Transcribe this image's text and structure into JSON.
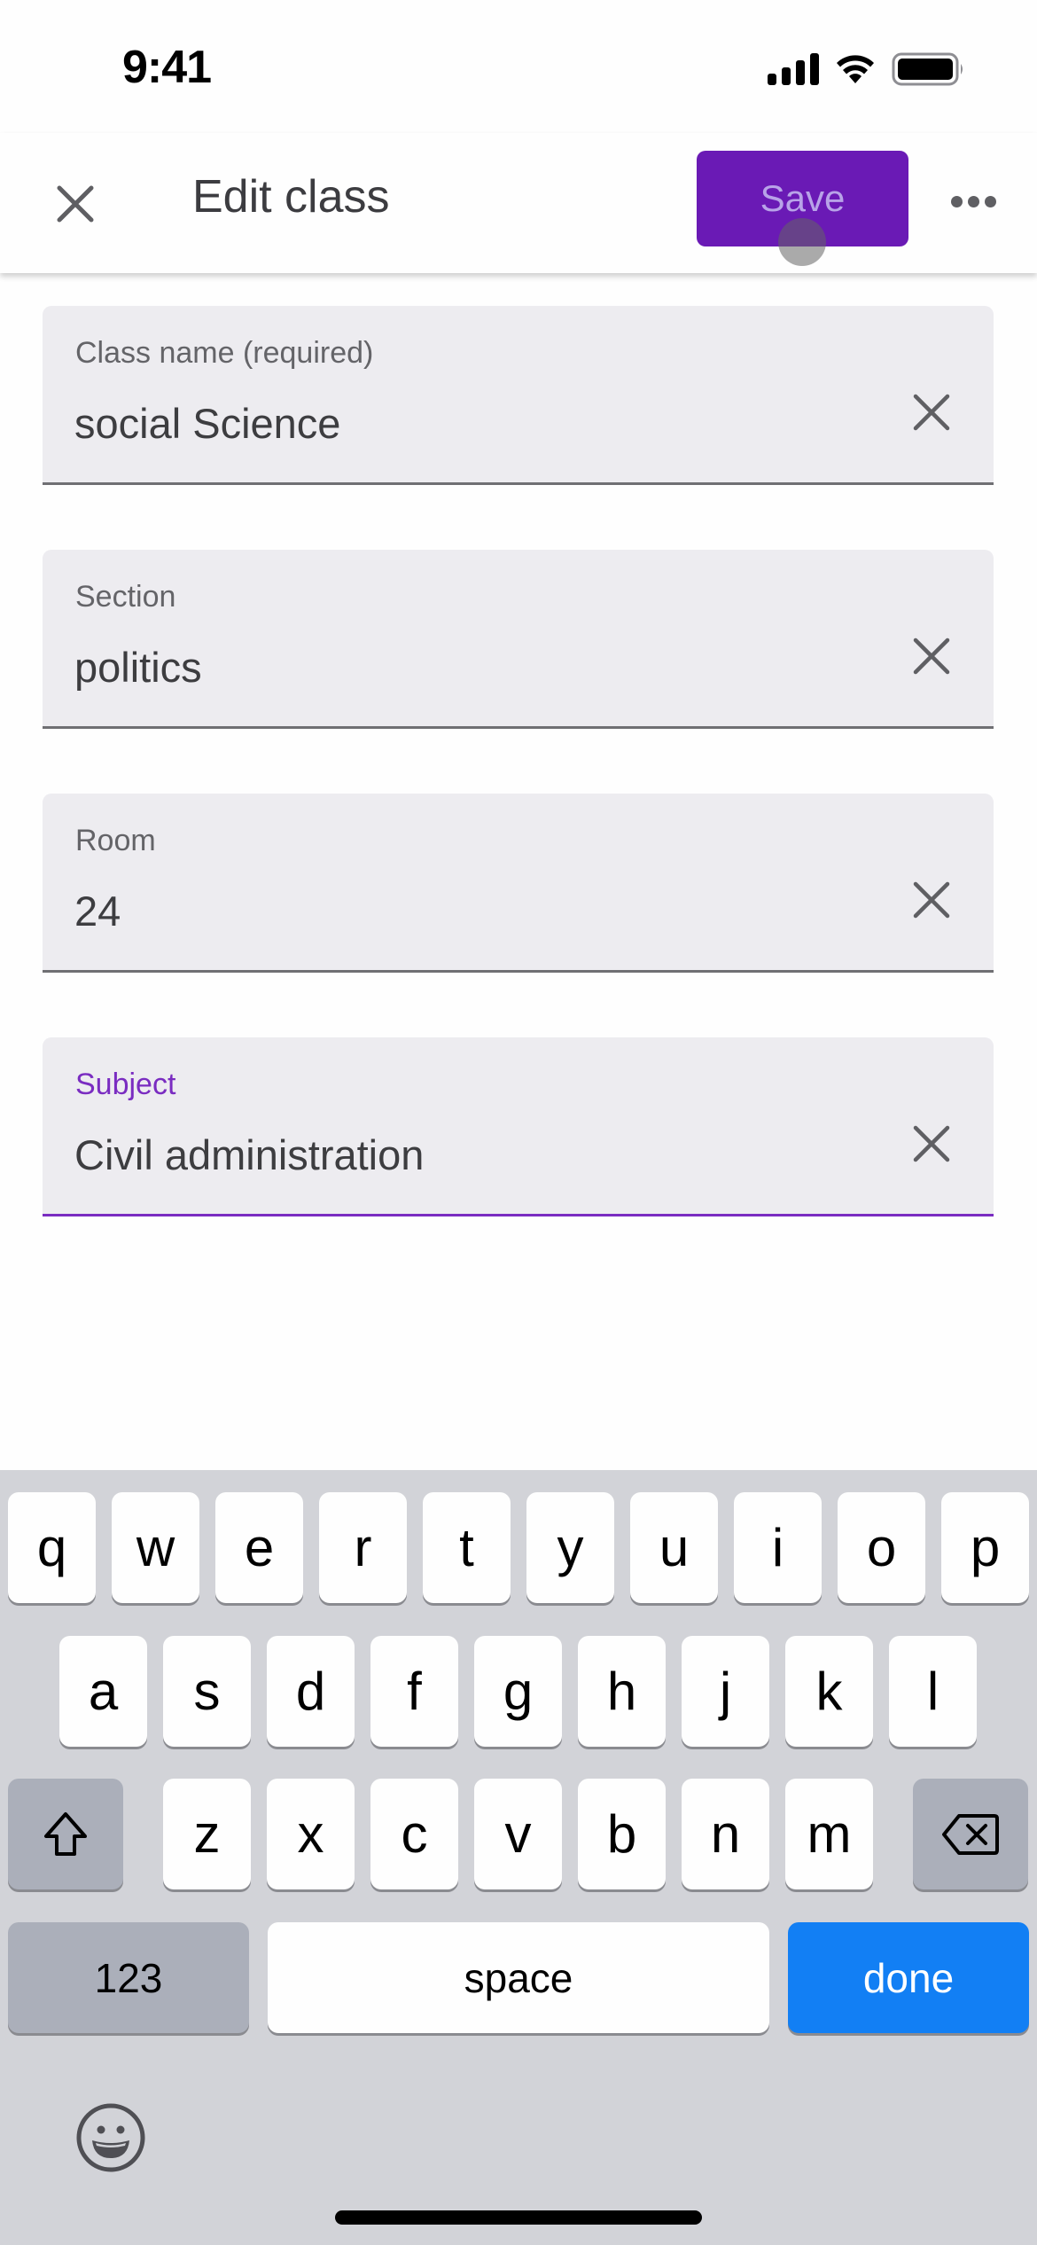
{
  "status_bar": {
    "time": "9:41",
    "icons": [
      "signal-icon",
      "wifi-icon",
      "battery-icon"
    ]
  },
  "app_bar": {
    "close_icon": "close-icon",
    "title": "Edit class",
    "save_label": "Save",
    "more_icon": "more-horizontal-icon"
  },
  "colors": {
    "accent": "#6a1ab5",
    "save_text": "#b8a3e8",
    "focus": "#7a2cc1",
    "field_bg": "#edecf0",
    "keyboard_bg": "#d2d3d8",
    "done_key": "#127ff4"
  },
  "form": {
    "fields": [
      {
        "label": "Class name (required)",
        "value": "social Science",
        "focused": false
      },
      {
        "label": "Section",
        "value": "politics",
        "focused": false
      },
      {
        "label": "Room",
        "value": "24",
        "focused": false
      },
      {
        "label": "Subject",
        "value": "Civil administration",
        "focused": true
      }
    ]
  },
  "keyboard": {
    "row1": [
      "q",
      "w",
      "e",
      "r",
      "t",
      "y",
      "u",
      "i",
      "o",
      "p"
    ],
    "row2": [
      "a",
      "s",
      "d",
      "f",
      "g",
      "h",
      "j",
      "k",
      "l"
    ],
    "row3": [
      "z",
      "x",
      "c",
      "v",
      "b",
      "n",
      "m"
    ],
    "shift_icon": "shift-icon",
    "delete_icon": "backspace-icon",
    "numbers_label": "123",
    "space_label": "space",
    "done_label": "done",
    "emoji_icon": "emoji-icon"
  }
}
